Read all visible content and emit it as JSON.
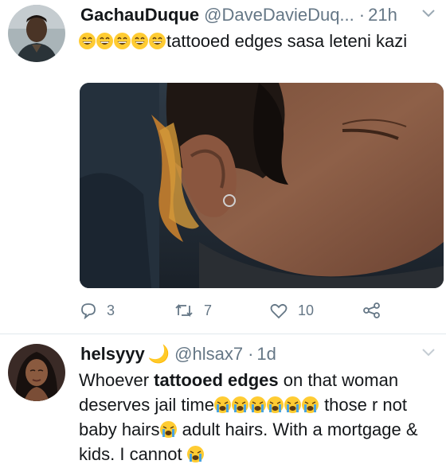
{
  "tweets": [
    {
      "name": "GachauDuque",
      "handle": "@DaveDavieDuq...",
      "separator": "·",
      "time": "21h",
      "text_before_emoji": "",
      "emoji_count": 5,
      "text_after_emoji": "tattooed edges sasa leteni kazi",
      "actions": {
        "replies": "3",
        "retweets": "7",
        "likes": "10"
      }
    },
    {
      "name": "helsyyy",
      "name_emoji": "🌙",
      "handle": "@hlsax7",
      "separator": "·",
      "time": "1d",
      "text_1": "Whoever ",
      "text_bold": "tattooed edges",
      "text_2": " on that woman deserves jail time",
      "crying_emoji_count_1": 6,
      "text_3": " those r not baby hairs",
      "text_4": " adult hairs. With a mortgage & kids. I cannot "
    }
  ],
  "colors": {
    "text_primary": "#14171a",
    "text_secondary": "#657786",
    "divider": "#e1e8ed",
    "emoji_yellow": "#ffcc33"
  },
  "icons": [
    "reply-icon",
    "retweet-icon",
    "like-icon",
    "share-icon",
    "chevron-down-icon"
  ]
}
